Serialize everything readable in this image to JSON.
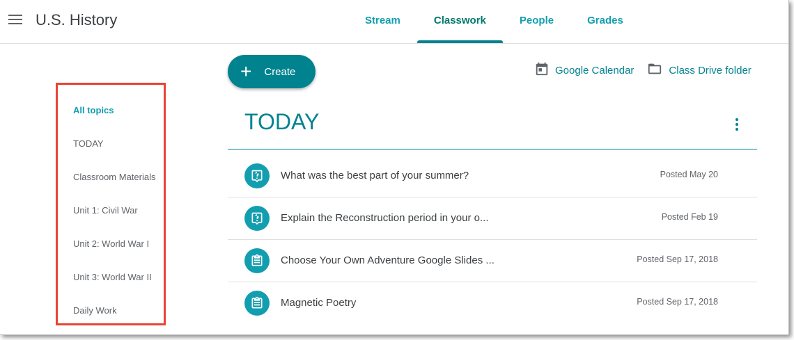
{
  "header": {
    "class_title": "U.S. History",
    "tabs": [
      {
        "label": "Stream"
      },
      {
        "label": "Classwork"
      },
      {
        "label": "People"
      },
      {
        "label": "Grades"
      }
    ],
    "active_tab": "Classwork"
  },
  "sidebar": {
    "topics": [
      {
        "label": "All topics"
      },
      {
        "label": "TODAY"
      },
      {
        "label": "Classroom Materials"
      },
      {
        "label": "Unit 1: Civil War"
      },
      {
        "label": "Unit 2: World War I"
      },
      {
        "label": "Unit 3: World War II"
      },
      {
        "label": "Daily Work"
      }
    ],
    "active_topic": "All topics"
  },
  "toolbar": {
    "create_label": "Create",
    "calendar_label": "Google Calendar",
    "drive_label": "Class Drive folder"
  },
  "section": {
    "title": "TODAY",
    "items": [
      {
        "title": "What was the best part of your summer?",
        "date": "Posted May 20",
        "icon": "question-icon"
      },
      {
        "title": "Explain the Reconstruction period in your o...",
        "date": "Posted Feb 19",
        "icon": "question-icon"
      },
      {
        "title": "Choose Your Own Adventure Google Slides ...",
        "date": "Posted Sep 17, 2018",
        "icon": "assignment-icon"
      },
      {
        "title": "Magnetic Poetry",
        "date": "Posted Sep 17, 2018",
        "icon": "assignment-icon"
      }
    ]
  },
  "colors": {
    "accent": "#00838f",
    "accent_light": "#129eaf",
    "highlight_box": "#ea4335"
  }
}
